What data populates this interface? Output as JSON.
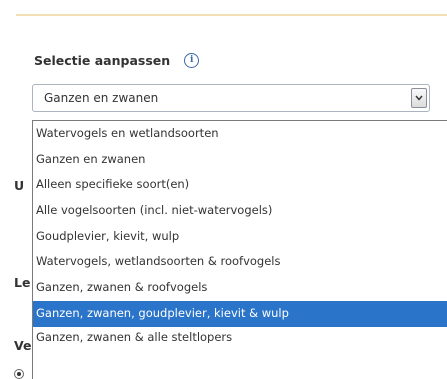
{
  "selection": {
    "label": "Selectie aanpassen",
    "info_icon": "info-icon",
    "current_value": "Ganzen en zwanen"
  },
  "background_labels": {
    "row1": "U",
    "row2": "Le",
    "row3": "Ve"
  },
  "dropdown": {
    "options": [
      "Watervogels en wetlandsoorten",
      "Ganzen en zwanen",
      "Alleen specifieke soort(en)",
      "Alle vogelsoorten (incl. niet-watervogels)",
      "Goudplevier, kievit, wulp",
      "Watervogels, wetlandsoorten & roofvogels",
      "Ganzen, zwanen & roofvogels",
      "Ganzen, zwanen, goudplevier, kievit & wulp",
      "Ganzen, zwanen & alle steltlopers"
    ],
    "highlighted_option": "Ganzen, zwanen, goudplevier, kievit & wulp"
  },
  "colors": {
    "highlight": "#2a74c9",
    "accent_rule": "#f2dfb6",
    "info_icon": "#3a68a8"
  }
}
